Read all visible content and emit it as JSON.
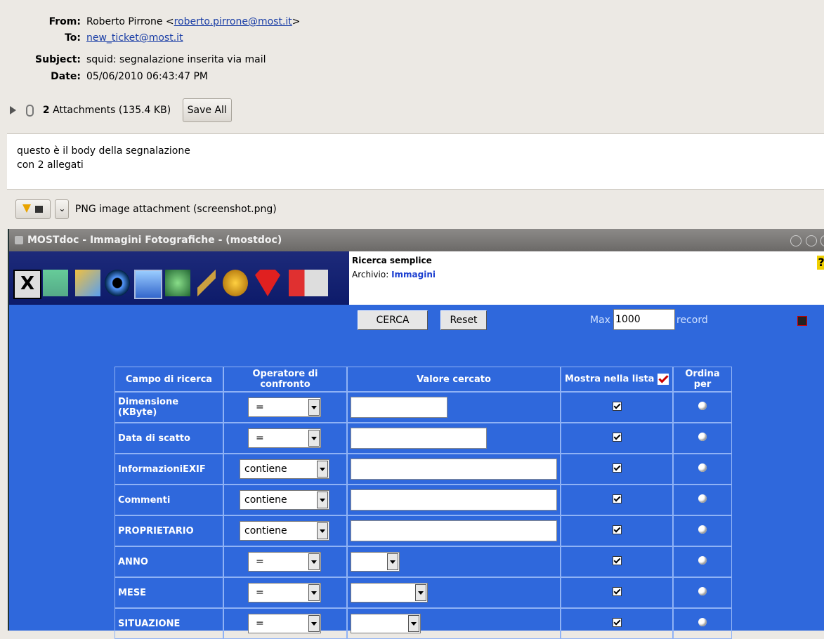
{
  "email": {
    "from_label": "From:",
    "from_name": "Roberto Pirrone <",
    "from_email": "roberto.pirrone@most.it",
    "from_close": ">",
    "to_label": "To:",
    "to_value": "new_ticket@most.it",
    "subject_label": "Subject:",
    "subject_value": "squid: segnalazione inserita via mail",
    "date_label": "Date:",
    "date_value": "05/06/2010 06:43:47 PM",
    "attachments_count": "2",
    "attachments_text": "Attachments (135.4 KB)",
    "save_all_label": "Save All",
    "body_line1": "questo è il body della segnalazione",
    "body_line2": "con 2 allegati",
    "attachment_name": "PNG image attachment (screenshot.png)"
  },
  "app": {
    "window_title": "MOSTdoc - Immagini Fotografiche - (mostdoc)",
    "info_title": "Ricerca semplice",
    "archive_label": "Archivio:",
    "archive_value": "Immagini",
    "search_button": "CERCA",
    "reset_button": "Reset",
    "max_label": "Max",
    "max_value": "1000",
    "record_label": "record",
    "columns": [
      "Campo di ricerca",
      "Operatore di confronto",
      "Valore cercato",
      "Mostra nella lista",
      "Ordina per"
    ],
    "rows": [
      {
        "field": "Dimensione (KByte)",
        "operator": "="
      },
      {
        "field": "Data di scatto",
        "operator": "="
      },
      {
        "field": "InformazioniEXIF",
        "operator": "contiene"
      },
      {
        "field": "Commenti",
        "operator": "contiene"
      },
      {
        "field": "PROPRIETARIO",
        "operator": "contiene"
      },
      {
        "field": "ANNO",
        "operator": "="
      },
      {
        "field": "MESE",
        "operator": "="
      },
      {
        "field": "SITUAZIONE",
        "operator": "="
      }
    ]
  },
  "colors": {
    "toolbar_bg": "#0d1b6a",
    "form_bg": "#2f68dc",
    "header_bg": "#ece9e4"
  }
}
